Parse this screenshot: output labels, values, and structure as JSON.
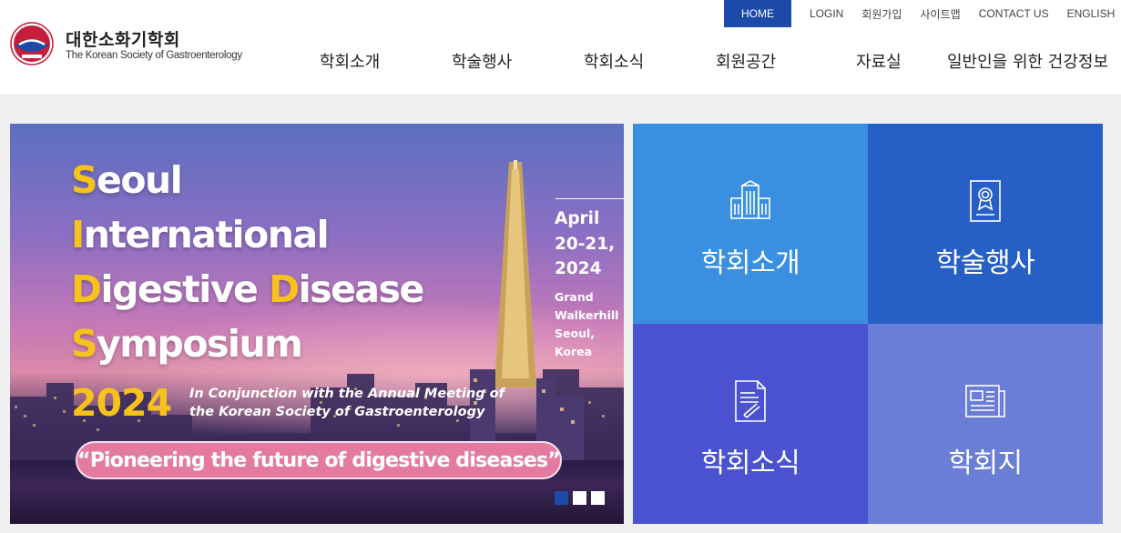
{
  "header": {
    "logo_ko": "대한소화기학회",
    "logo_en": "The Korean Society of Gastroenterology",
    "util_home": "HOME",
    "util_links": [
      "LOGIN",
      "회원가입",
      "사이트맵",
      "CONTACT US",
      "ENGLISH"
    ],
    "nav": [
      "학회소개",
      "학술행사",
      "학회소식",
      "회원공간",
      "자료실",
      "일반인을 위한 건강정보"
    ]
  },
  "banner": {
    "title_lines": [
      {
        "cap": "S",
        "rest": "eoul"
      },
      {
        "cap": "I",
        "rest": "nternational"
      },
      {
        "cap": "D",
        "rest": "igestive ",
        "cap2": "D",
        "rest2": "isease"
      },
      {
        "cap": "S",
        "rest": "ymposium"
      }
    ],
    "year": "2024",
    "conjunction_1": "In Conjunction with the Annual Meeting of",
    "conjunction_2": "the Korean Society of Gastroenterology",
    "tagline": "“Pioneering the future of digestive diseases”",
    "date_1": "April",
    "date_2": "20-21,",
    "date_3": "2024",
    "venue_1": "Grand",
    "venue_2": "Walkerhill",
    "venue_3": "Seoul,",
    "venue_4": "Korea",
    "slide_count": 3,
    "active_slide": 1
  },
  "tiles": [
    {
      "label": "학회소개",
      "icon": "building-icon",
      "color": "#3a8fe0"
    },
    {
      "label": "학술행사",
      "icon": "certificate-icon",
      "color": "#2660c6"
    },
    {
      "label": "학회소식",
      "icon": "document-pen-icon",
      "color": "#4a52cf"
    },
    {
      "label": "학회지",
      "icon": "newspaper-icon",
      "color": "#6a7ed8"
    }
  ],
  "colors": {
    "brand_blue": "#1d4aa8",
    "accent_yellow": "#f6c21b",
    "pill_pink": "#e47aa0"
  }
}
